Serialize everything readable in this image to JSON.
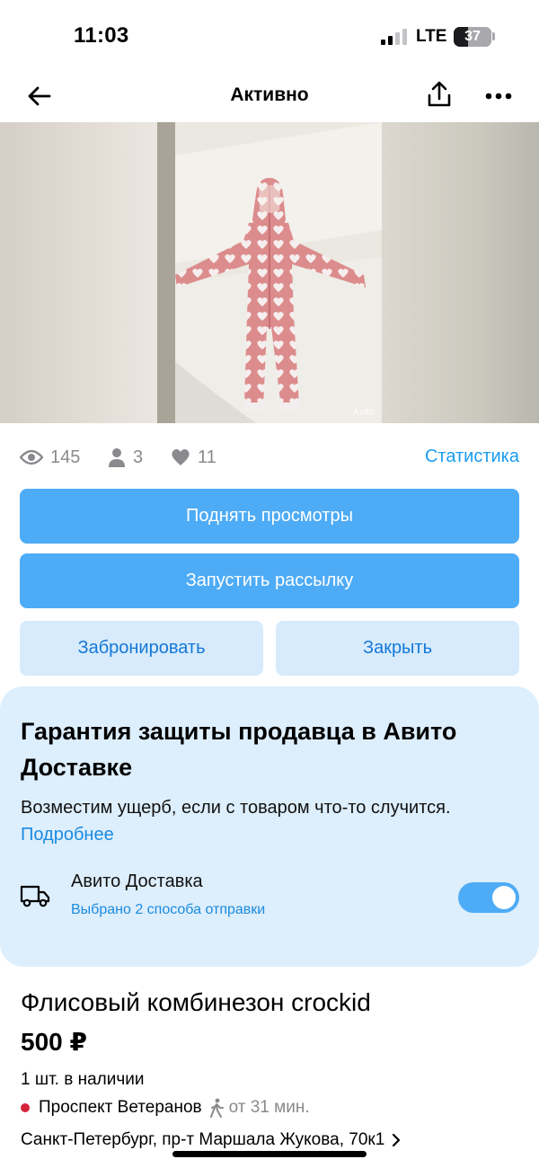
{
  "status_bar": {
    "time": "11:03",
    "network": "LTE",
    "battery": "37"
  },
  "nav": {
    "title": "Активно"
  },
  "gallery": {
    "watermark": "Avito"
  },
  "stats": {
    "views": "145",
    "contacts": "3",
    "favorites": "11",
    "link": "Статистика"
  },
  "actions": {
    "raise_views": "Поднять просмотры",
    "start_mailing": "Запустить рассылку",
    "reserve": "Забронировать",
    "close": "Закрыть"
  },
  "guarantee": {
    "title": "Гарантия защиты продавца в Авито Доставке",
    "text": "Возместим ущерб, если с товаром что-то случится.",
    "link": "Подробнее",
    "delivery_title": "Авито Доставка",
    "delivery_sub": "Выбрано 2 способа отправки",
    "toggle_on": true
  },
  "item": {
    "title": "Флисовый комбинезон crockid",
    "price": "500 ₽",
    "stock": "1 шт. в наличии",
    "metro": "Проспект Ветеранов",
    "walk": "от 31 мин.",
    "address": "Санкт-Петербург, пр-т Маршала Жукова, 70к1"
  },
  "colors": {
    "accent": "#4eabf5",
    "link": "#1a9bf0",
    "secondary_bg": "#d7ebfc",
    "card_bg": "#ddeefc",
    "metro": "#d6243c"
  }
}
